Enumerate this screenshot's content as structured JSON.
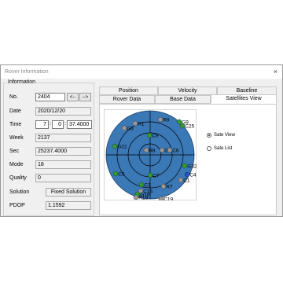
{
  "window": {
    "title": "Rover Information",
    "close_glyph": "×"
  },
  "info": {
    "group_label": "Information",
    "no_label": "No.",
    "no_value": "2404",
    "prev_btn": "<--",
    "next_btn": "-->",
    "date_label": "Date",
    "date_value": "2020/12/20",
    "time_label": "Time",
    "time_h": "7",
    "time_m": "0",
    "time_s": "37.4000",
    "week_label": "Week",
    "week_value": "2137",
    "sec_label": "Sec",
    "sec_value": "25237.4000",
    "mode_label": "Mode",
    "mode_value": "18",
    "quality_label": "Quality",
    "quality_value": "0",
    "solution_label": "Solution",
    "solution_value": "Fixed Solution",
    "pdop_label": "PDOP",
    "pdop_value": "1.1592"
  },
  "tabs": {
    "row1": [
      "Position",
      "Velocity",
      "Baseline"
    ],
    "row2": [
      "Rover Data",
      "Base Data",
      "Satellites View"
    ],
    "active": "Satellites View"
  },
  "radios": {
    "sate_view": "Sate View",
    "sate_list": "Sate List",
    "selected": "Sate View"
  },
  "colors": {
    "sky": "#3a78b6",
    "gps": "#2f9e2f",
    "glonass": "#999999",
    "bds": "#2255cc"
  },
  "satellites": [
    {
      "id": "R1",
      "color": "#999999"
    },
    {
      "id": "G3",
      "color": "#999999"
    },
    {
      "id": "G9",
      "color": "#2f9e2f"
    },
    {
      "id": "R9",
      "color": "#999999"
    },
    {
      "id": "C25",
      "color": "#2f9e2f"
    },
    {
      "id": "C9",
      "color": "#2f9e2f"
    },
    {
      "id": "G22",
      "color": "#2f9e2f"
    },
    {
      "id": "R8",
      "color": "#999999"
    },
    {
      "id": "G6",
      "color": "#999999"
    },
    {
      "id": "C6",
      "color": "#999999"
    },
    {
      "id": "G32",
      "color": "#2f9e2f"
    },
    {
      "id": "C5",
      "color": "#2f9e2f"
    },
    {
      "id": "C7",
      "color": "#2f9e2f"
    },
    {
      "id": "C4",
      "color": "#2255cc"
    },
    {
      "id": "C1",
      "color": "#999999"
    },
    {
      "id": "C3",
      "color": "#2f9e2f"
    },
    {
      "id": "R7",
      "color": "#999999"
    },
    {
      "id": "C16",
      "color": "#999999"
    },
    {
      "id": "G18",
      "color": "#2f9e2f"
    },
    {
      "id": "R19",
      "color": "#999999"
    },
    {
      "id": "C19",
      "color": "#999999"
    }
  ]
}
